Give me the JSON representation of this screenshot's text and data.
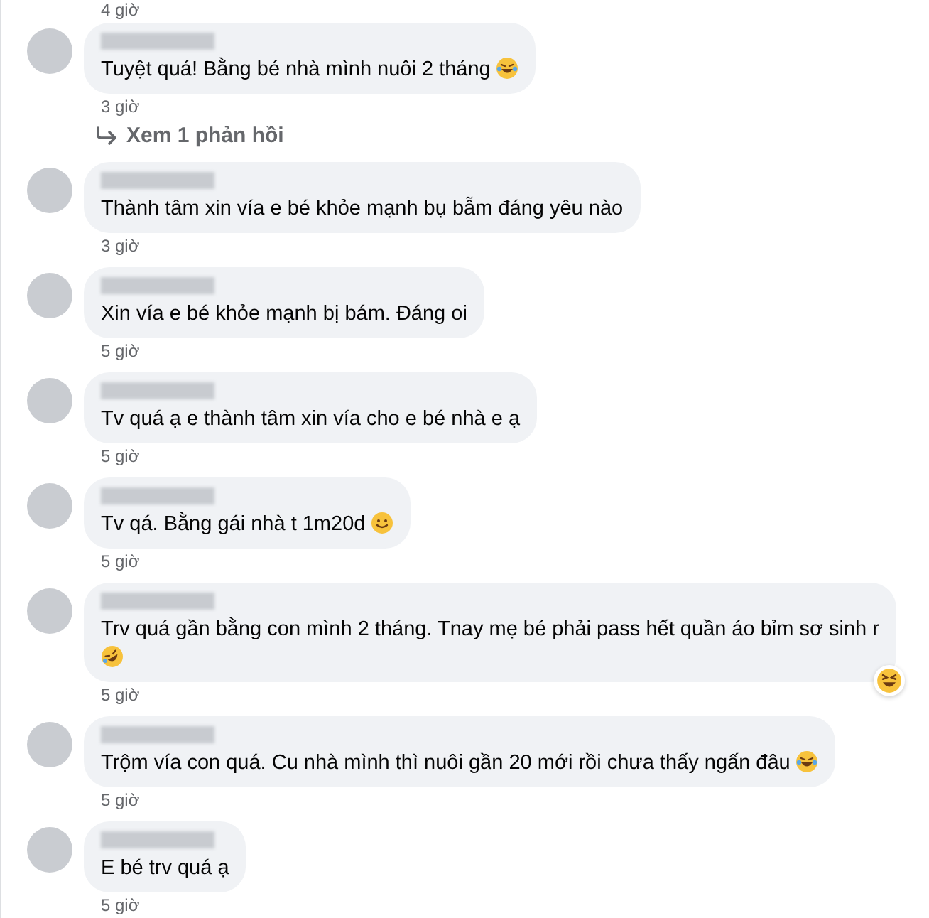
{
  "top_time": "4 giờ",
  "comments": [
    {
      "text": "Tuyệt quá! Bằng bé nhà mình nuôi 2 tháng",
      "emoji": {
        "kind": "tears_of_joy"
      },
      "time": "3 giờ",
      "replies_link": "Xem 1 phản hồi"
    },
    {
      "text": "Thành tâm xin vía e bé khỏe mạnh bụ bẫm đáng yêu nào",
      "time": "3 giờ"
    },
    {
      "text": "Xin vía e bé khỏe mạnh bị bám. Đáng oi",
      "time": "5 giờ"
    },
    {
      "text": "Tv quá ạ e thành tâm xin vía cho e bé nhà e ạ",
      "time": "5 giờ"
    },
    {
      "text": "Tv qá. Bằng gái nhà t 1m20d",
      "emoji": {
        "kind": "smile"
      },
      "time": "5 giờ"
    },
    {
      "text": "Trv quá gần bằng con mình 2 tháng. Tnay mẹ bé phải pass hết quần áo bỉm sơ sinh r",
      "emoji": {
        "kind": "rofl"
      },
      "emoji_on_new_line": true,
      "time": "5 giờ",
      "reaction": {
        "kind": "haha"
      }
    },
    {
      "text": "Trộm vía con quá. Cu nhà mình thì nuôi gần 20 mới rồi chưa thấy ngấn đâu",
      "emoji": {
        "kind": "tears_of_joy"
      },
      "time": "5 giờ"
    },
    {
      "text": "E bé trv quá ạ",
      "time": "5 giờ"
    }
  ]
}
